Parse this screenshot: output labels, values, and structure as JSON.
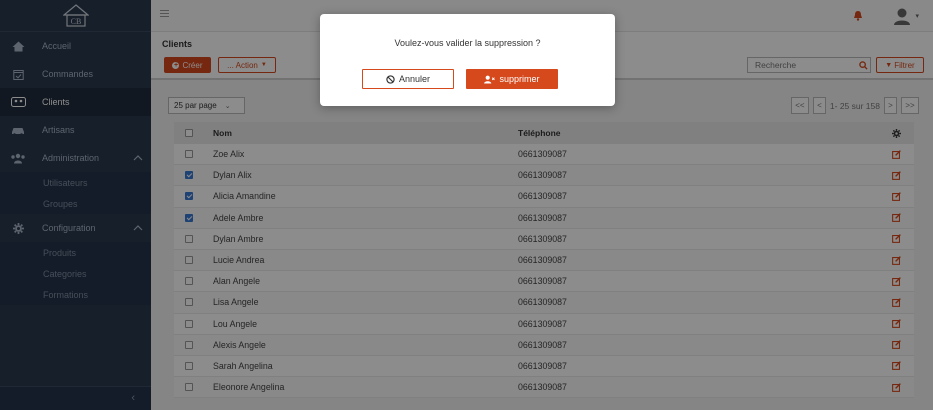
{
  "brand": {
    "logo_text": "CB"
  },
  "colors": {
    "accent": "#d6491c",
    "sidebar_bg": "#2a3a4f",
    "checkbox_on": "#3a78d6"
  },
  "sidebar": {
    "items": [
      {
        "label": "Accueil",
        "icon": "home-icon"
      },
      {
        "label": "Commandes",
        "icon": "calendar-check-icon"
      },
      {
        "label": "Clients",
        "icon": "users-chat-icon",
        "active": true
      },
      {
        "label": "Artisans",
        "icon": "car-icon"
      },
      {
        "label": "Administration",
        "icon": "group-icon",
        "expanded": true,
        "children": [
          "Utilisateurs",
          "Groupes"
        ]
      },
      {
        "label": "Configuration",
        "icon": "gear-icon",
        "expanded": true,
        "children": [
          "Produits",
          "Categories",
          "Formations"
        ]
      }
    ],
    "collapse_glyph": "‹"
  },
  "header": {
    "title": "Clients",
    "create_label": "Créer",
    "action_label": "... Action",
    "search_placeholder": "Recherche",
    "filter_label": "Filtrer"
  },
  "toolbar": {
    "per_page": "25 par page",
    "pagination_info": "1- 25 sur 158",
    "first": "<<",
    "prev": "<",
    "next": ">",
    "last": ">>"
  },
  "table": {
    "columns": [
      "Nom",
      "Téléphone"
    ],
    "rows": [
      {
        "name": "Zoe  Alix",
        "phone": "0661309087",
        "checked": false
      },
      {
        "name": "Dylan  Alix",
        "phone": "0661309087",
        "checked": true
      },
      {
        "name": "Alicia  Amandine",
        "phone": "0661309087",
        "checked": true
      },
      {
        "name": "Adele  Ambre",
        "phone": "0661309087",
        "checked": true
      },
      {
        "name": "Dylan  Ambre",
        "phone": "0661309087",
        "checked": false
      },
      {
        "name": "Lucie  Andrea",
        "phone": "0661309087",
        "checked": false
      },
      {
        "name": "Alan  Angele",
        "phone": "0661309087",
        "checked": false
      },
      {
        "name": "Lisa  Angele",
        "phone": "0661309087",
        "checked": false
      },
      {
        "name": "Lou  Angele",
        "phone": "0661309087",
        "checked": false
      },
      {
        "name": "Alexis  Angele",
        "phone": "0661309087",
        "checked": false
      },
      {
        "name": "Sarah  Angelina",
        "phone": "0661309087",
        "checked": false
      },
      {
        "name": "Eleonore  Angelina",
        "phone": "0661309087",
        "checked": false
      }
    ]
  },
  "modal": {
    "message": "Voulez-vous valider la suppression ?",
    "cancel_label": "Annuler",
    "delete_label": "supprimer"
  }
}
